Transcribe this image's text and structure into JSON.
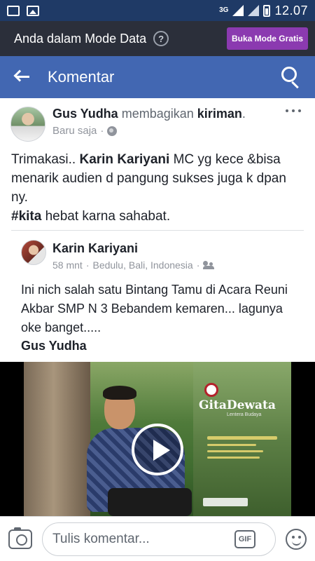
{
  "status_bar": {
    "network": "3G",
    "time": "12.07"
  },
  "data_mode_bar": {
    "text": "Anda dalam Mode Data",
    "help_icon": "?",
    "button_label": "Buka Mode Gratis",
    "button_color": "#8b3ab0"
  },
  "header": {
    "title": "Komentar",
    "back_icon": "back-arrow-icon",
    "search_icon": "search-icon",
    "color": "#4267b2"
  },
  "post": {
    "author": "Gus Yudha",
    "action_text": "membagikan",
    "object_text": "kiriman",
    "time": "Baru saja",
    "privacy_icon": "globe-icon",
    "text_part1": "Trimakasi.. ",
    "mention": "Karin Kariyani",
    "text_part2": " MC yg kece &bisa menarik audien d pangung sukses juga k dpan ny.",
    "hashtag": "#kita",
    "text_part3": " hebat karna sahabat."
  },
  "shared_post": {
    "author": "Karin Kariyani",
    "time": "58 mnt",
    "location": "Bedulu, Bali, Indonesia",
    "audience_icon": "friends-icon",
    "text": "Ini nich salah satu Bintang Tamu di Acara Reuni Akbar SMP N 3 Bebandem kemaren... lagunya oke banget.....",
    "tag": "Gus Yudha"
  },
  "video": {
    "brand": "GitaDewata",
    "brand_sub": "Lentera Budaya",
    "play_icon": "play-icon"
  },
  "comment_bar": {
    "placeholder": "Tulis komentar...",
    "camera_icon": "camera-icon",
    "gif_label": "GIF",
    "emoji_icon": "emoji-icon"
  }
}
